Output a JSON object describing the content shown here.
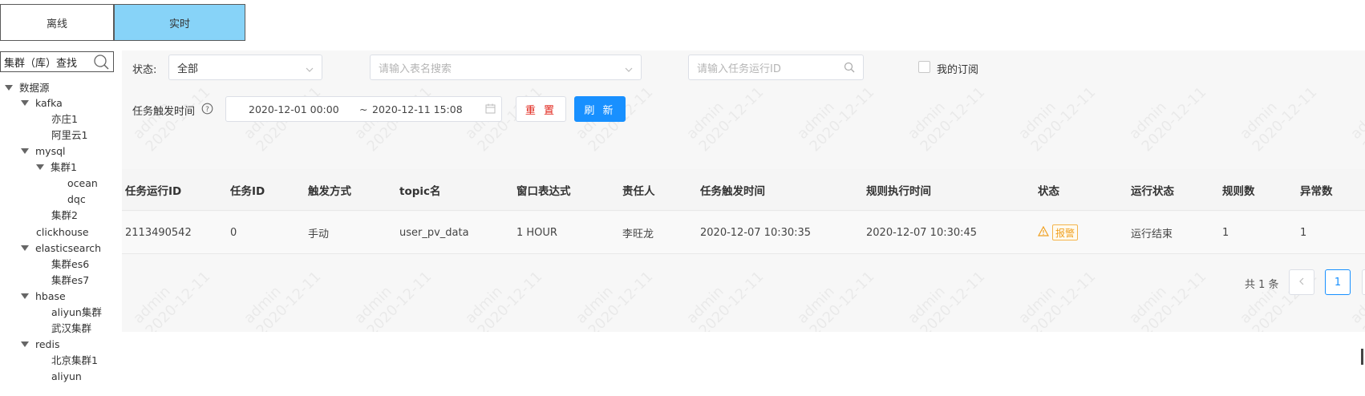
{
  "tabs": [
    {
      "label": "离线",
      "active": false
    },
    {
      "label": "实时",
      "active": true
    }
  ],
  "sidebar": {
    "search_label": "集群（库）查找",
    "tree": [
      {
        "label": "数据源",
        "level": 0,
        "expanded": true
      },
      {
        "label": "kafka",
        "level": 1,
        "expanded": true
      },
      {
        "label": "亦庄1",
        "level": 2
      },
      {
        "label": "阿里云1",
        "level": 2
      },
      {
        "label": "mysql",
        "level": 1,
        "expanded": true
      },
      {
        "label": "集群1",
        "level": 2,
        "expanded": true
      },
      {
        "label": "ocean",
        "level": 3
      },
      {
        "label": "dqc",
        "level": 3
      },
      {
        "label": "集群2",
        "level": 2
      },
      {
        "label": "clickhouse",
        "level": 1
      },
      {
        "label": "elasticsearch",
        "level": 1,
        "expanded": true
      },
      {
        "label": "集群es6",
        "level": 2
      },
      {
        "label": "集群es7",
        "level": 2
      },
      {
        "label": "hbase",
        "level": 1,
        "expanded": true
      },
      {
        "label": "aliyun集群",
        "level": 2
      },
      {
        "label": "武汉集群",
        "level": 2
      },
      {
        "label": "redis",
        "level": 1,
        "expanded": true
      },
      {
        "label": "北京集群1",
        "level": 2
      },
      {
        "label": "aliyun",
        "level": 2
      }
    ]
  },
  "filters": {
    "status_label": "状态:",
    "status_value": "全部",
    "table_search_placeholder": "请输入表名搜索",
    "task_id_placeholder": "请输入任务运行ID",
    "my_subscription_label": "我的订阅",
    "trigger_time_label": "任务触发时间",
    "date_start": "2020-12-01 00:00",
    "date_sep": "~",
    "date_end": "2020-12-11 15:08",
    "reset_label": "重 置",
    "refresh_label": "刷 新"
  },
  "table": {
    "columns": [
      "任务运行ID",
      "任务ID",
      "触发方式",
      "topic名",
      "窗口表达式",
      "责任人",
      "任务触发时间",
      "规则执行时间",
      "状态",
      "运行状态",
      "规则数",
      "异常数"
    ],
    "rows": [
      {
        "run_id": "2113490542",
        "task_id": "0",
        "trigger": "手动",
        "topic": "user_pv_data",
        "window": "1 HOUR",
        "owner": "李旺龙",
        "trigger_time": "2020-12-07 10:30:35",
        "exec_time": "2020-12-07 10:30:45",
        "status": "报警",
        "run_status": "运行结束",
        "rule_count": "1",
        "exception_count": "1"
      }
    ]
  },
  "pagination": {
    "total_text": "共 1 条",
    "current_page": "1"
  },
  "watermark": {
    "user": "admin",
    "date": "2020-12-11"
  },
  "colors": {
    "active_tab": "#87d3f8",
    "primary": "#1890ff",
    "danger": "#e1251b",
    "warning": "#f0a020"
  }
}
